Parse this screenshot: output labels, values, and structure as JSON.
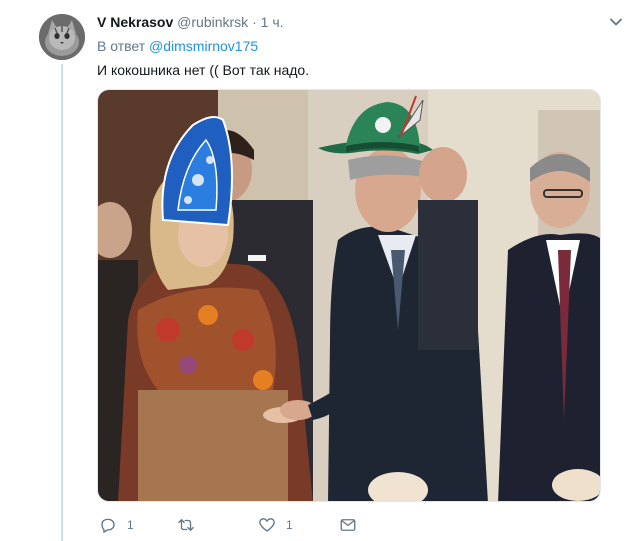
{
  "tweet": {
    "author_name": "V Nekrasov",
    "author_handle": "@rubinkrsk",
    "separator": "·",
    "time": "1 ч.",
    "reply_prefix": "В ответ",
    "reply_to_handle": "@dimsmirnov175",
    "text": "И кокошника нет (( Вот так надо."
  },
  "actions": {
    "reply_count": "1",
    "retweet_count": "",
    "like_count": "1"
  },
  "colors": {
    "link": "#1b95e0",
    "muted": "#657786",
    "thread_line": "#c4e4f5"
  },
  "icons": [
    "chevron-down-icon",
    "reply-icon",
    "retweet-icon",
    "heart-icon",
    "message-icon"
  ]
}
